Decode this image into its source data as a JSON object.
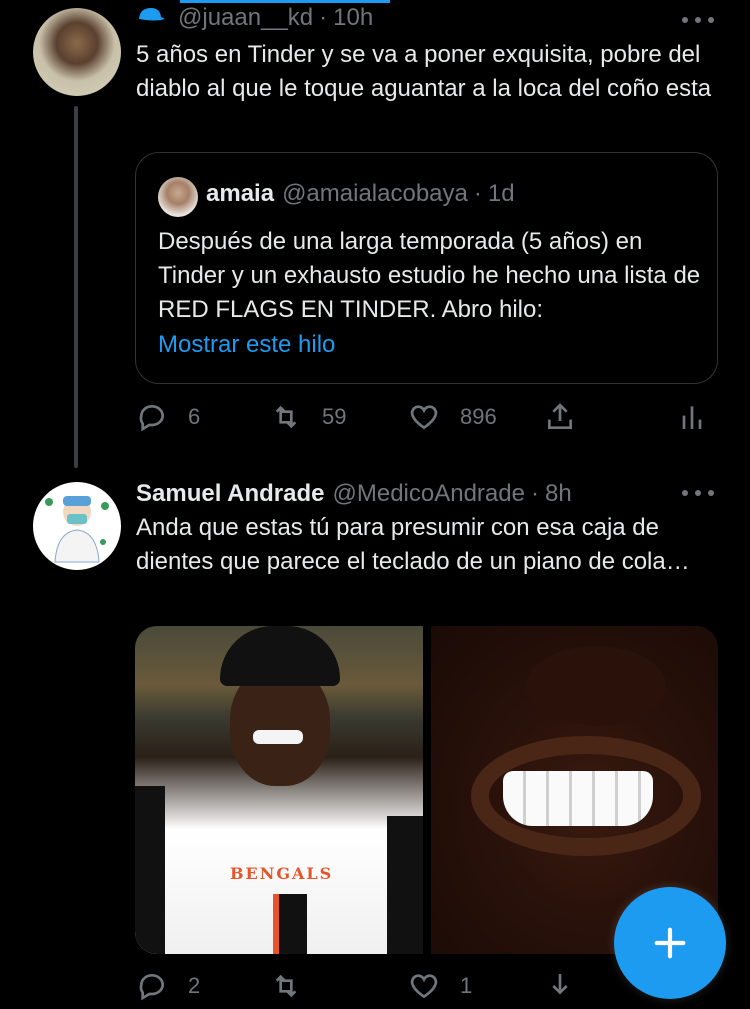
{
  "tweet1": {
    "icon": "cap-icon",
    "handle": "@juaan__kd",
    "dot": "·",
    "time": "10h",
    "text": "5 años en Tinder y se va a poner exquisita, pobre del diablo al que le toque aguantar a la loca del coño esta",
    "quote": {
      "name": "amaia",
      "handle": "@amaialacobaya",
      "dot": "·",
      "time": "1d",
      "text": "Después de una larga temporada (5 años) en Tinder y un exhausto estudio he hecho una lista de RED FLAGS EN TINDER. Abro hilo:",
      "link": "Mostrar este hilo"
    },
    "actions": {
      "replies": "6",
      "retweets": "59",
      "likes": "896"
    }
  },
  "tweet2": {
    "name": "Samuel Andrade",
    "handle": "@MedicoAndrade",
    "dot": "·",
    "time": "8h",
    "text": "Anda que estas tú para presumir con esa caja de dientes que parece el teclado de un piano de cola…",
    "image_text": "BENGALS",
    "actions": {
      "replies": "2",
      "retweets": "",
      "likes": "1"
    }
  },
  "colors": {
    "accent": "#1d9bf0",
    "secondary_text": "#71767b",
    "border": "#2f3336",
    "background": "#000000"
  }
}
